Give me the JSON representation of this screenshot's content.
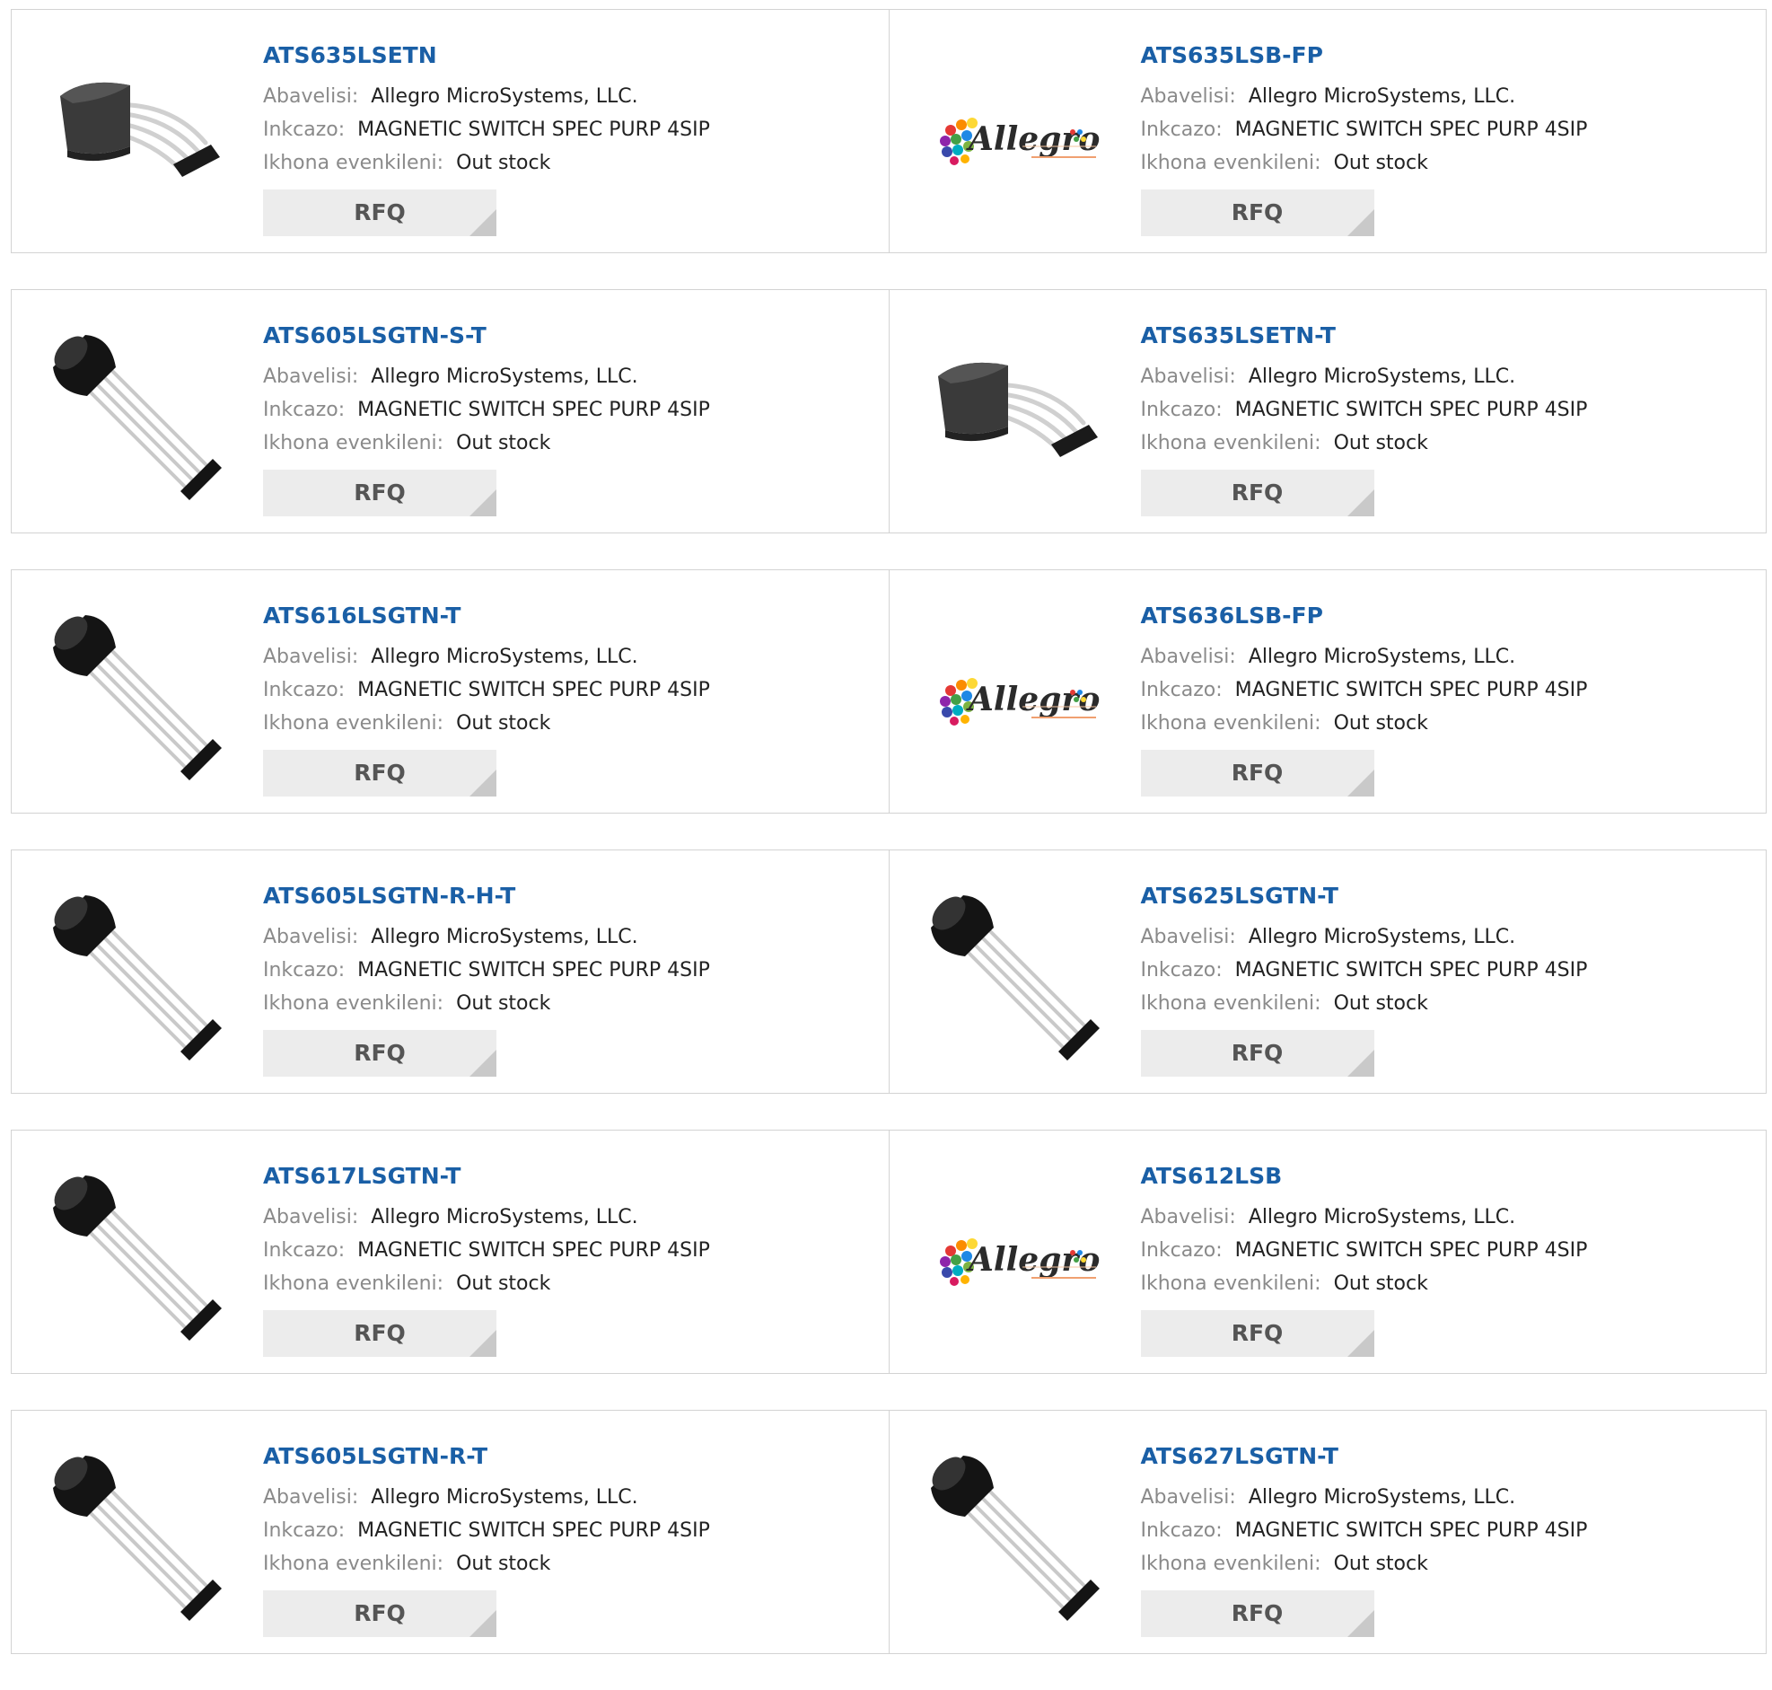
{
  "labels": {
    "manufacturer": "Abavelisi:",
    "description": "Inkcazo:",
    "stock": "Ikhona evenkileni:",
    "rfq": "RFQ"
  },
  "rows": [
    [
      {
        "part": "ATS635LSETN",
        "manufacturer": "Allegro MicroSystems, LLC.",
        "description": "MAGNETIC SWITCH SPEC PURP 4SIP",
        "stock": "Out stock",
        "image": "sip-cube-icon"
      },
      {
        "part": "ATS635LSB-FP",
        "manufacturer": "Allegro MicroSystems, LLC.",
        "description": "MAGNETIC SWITCH SPEC PURP 4SIP",
        "stock": "Out stock",
        "image": "allegro-logo"
      }
    ],
    [
      {
        "part": "ATS605LSGTN-S-T",
        "manufacturer": "Allegro MicroSystems, LLC.",
        "description": "MAGNETIC SWITCH SPEC PURP 4SIP",
        "stock": "Out stock",
        "image": "to92-sensor-icon"
      },
      {
        "part": "ATS635LSETN-T",
        "manufacturer": "Allegro MicroSystems, LLC.",
        "description": "MAGNETIC SWITCH SPEC PURP 4SIP",
        "stock": "Out stock",
        "image": "sip-cube-icon"
      }
    ],
    [
      {
        "part": "ATS616LSGTN-T",
        "manufacturer": "Allegro MicroSystems, LLC.",
        "description": "MAGNETIC SWITCH SPEC PURP 4SIP",
        "stock": "Out stock",
        "image": "to92-sensor-icon"
      },
      {
        "part": "ATS636LSB-FP",
        "manufacturer": "Allegro MicroSystems, LLC.",
        "description": "MAGNETIC SWITCH SPEC PURP 4SIP",
        "stock": "Out stock",
        "image": "allegro-logo"
      }
    ],
    [
      {
        "part": "ATS605LSGTN-R-H-T",
        "manufacturer": "Allegro MicroSystems, LLC.",
        "description": "MAGNETIC SWITCH SPEC PURP 4SIP",
        "stock": "Out stock",
        "image": "to92-sensor-icon"
      },
      {
        "part": "ATS625LSGTN-T",
        "manufacturer": "Allegro MicroSystems, LLC.",
        "description": "MAGNETIC SWITCH SPEC PURP 4SIP",
        "stock": "Out stock",
        "image": "to92-sensor-icon"
      }
    ],
    [
      {
        "part": "ATS617LSGTN-T",
        "manufacturer": "Allegro MicroSystems, LLC.",
        "description": "MAGNETIC SWITCH SPEC PURP 4SIP",
        "stock": "Out stock",
        "image": "to92-sensor-icon"
      },
      {
        "part": "ATS612LSB",
        "manufacturer": "Allegro MicroSystems, LLC.",
        "description": "MAGNETIC SWITCH SPEC PURP 4SIP",
        "stock": "Out stock",
        "image": "allegro-logo"
      }
    ],
    [
      {
        "part": "ATS605LSGTN-R-T",
        "manufacturer": "Allegro MicroSystems, LLC.",
        "description": "MAGNETIC SWITCH SPEC PURP 4SIP",
        "stock": "Out stock",
        "image": "to92-sensor-icon"
      },
      {
        "part": "ATS627LSGTN-T",
        "manufacturer": "Allegro MicroSystems, LLC.",
        "description": "MAGNETIC SWITCH SPEC PURP 4SIP",
        "stock": "Out stock",
        "image": "to92-sensor-icon"
      }
    ]
  ],
  "colors": {
    "part_link": "#1a5fa6",
    "label": "#8a8a8a",
    "value": "#222222",
    "rfq_bg": "#ececec",
    "border": "#d3d3d3"
  },
  "logo_text": "Allegro"
}
